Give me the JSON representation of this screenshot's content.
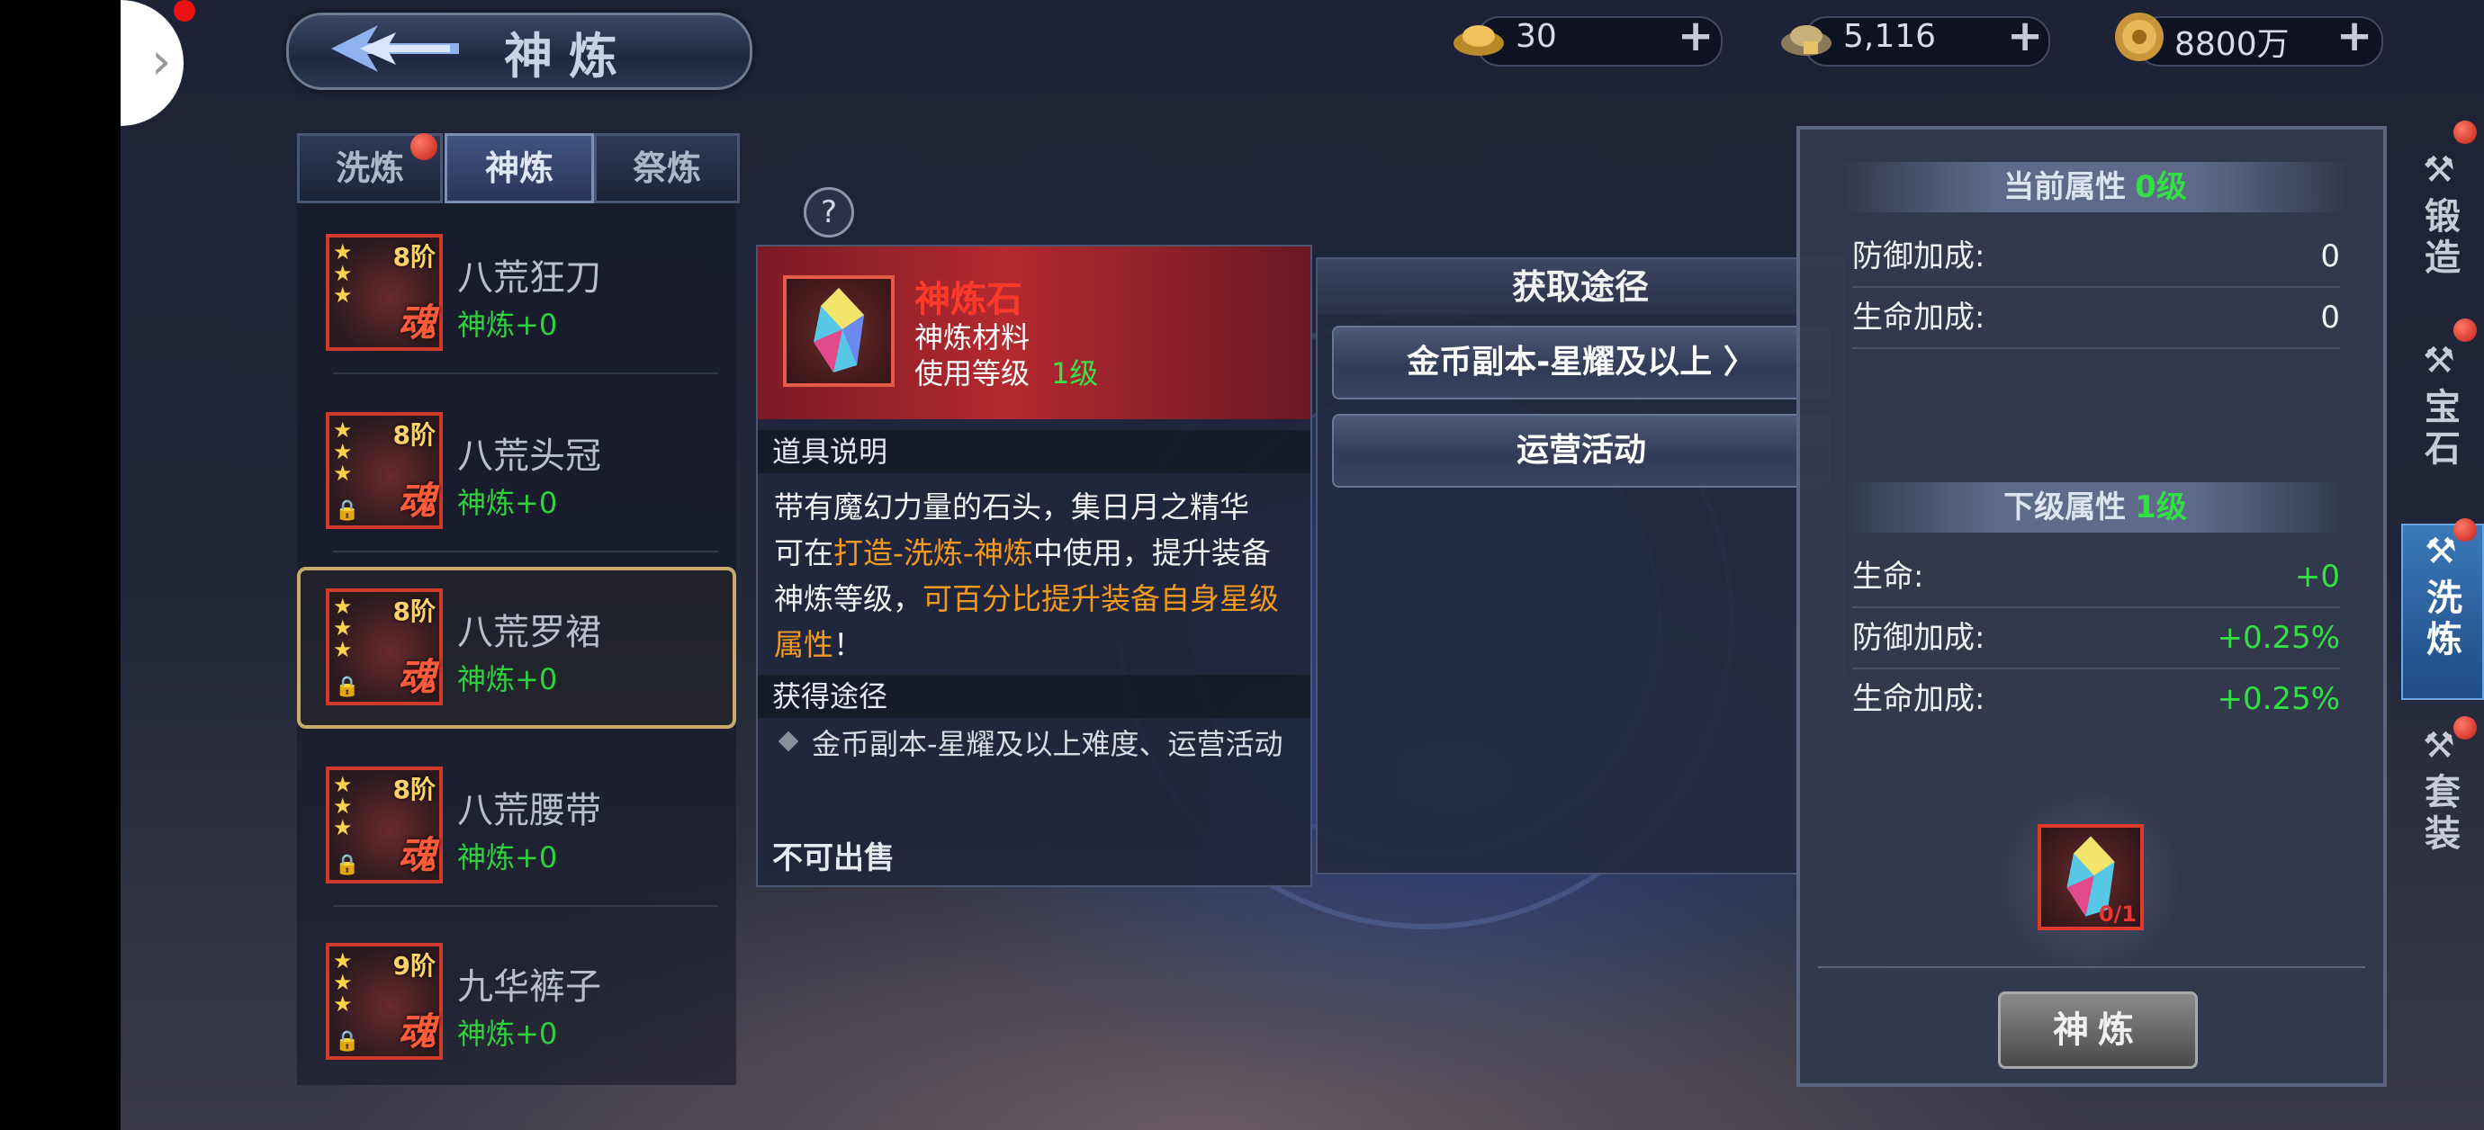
{
  "header": {
    "title": "神炼"
  },
  "currencies": [
    {
      "icon": "gold-ingot-icon",
      "value": "30"
    },
    {
      "icon": "locked-ingot-icon",
      "value": "5,116"
    },
    {
      "icon": "gold-coin-icon",
      "value": "8800万"
    }
  ],
  "tabs": [
    {
      "label": "洗炼",
      "has_dot": true
    },
    {
      "label": "神炼",
      "active": true
    },
    {
      "label": "祭炼"
    }
  ],
  "equipment": [
    {
      "name": "八荒狂刀",
      "tier": "8阶",
      "level": "神炼+0",
      "soul": "魂"
    },
    {
      "name": "八荒头冠",
      "tier": "8阶",
      "level": "神炼+0",
      "soul": "魂"
    },
    {
      "name": "八荒罗裙",
      "tier": "8阶",
      "level": "神炼+0",
      "soul": "魂",
      "selected": true
    },
    {
      "name": "八荒腰带",
      "tier": "8阶",
      "level": "神炼+0",
      "soul": "魂"
    },
    {
      "name": "九华裤子",
      "tier": "9阶",
      "level": "神炼+0",
      "soul": "魂"
    }
  ],
  "help": "?",
  "item_popup": {
    "name": "神炼石",
    "type": "神炼材料",
    "use_level_label": "使用等级",
    "use_level_value": "1级",
    "desc_header": "道具说明",
    "desc_1": "带有魔幻力量的石头，集日月之精华",
    "desc_2a": "可在",
    "desc_2b": "打造-洗炼-神炼",
    "desc_2c": "中使用，提升装备",
    "desc_3a": "神炼等级，",
    "desc_3b": "可百分比提升装备自身星级",
    "desc_4a": "属性",
    "desc_4b": "！",
    "route_header": "获得途径",
    "route_text": "金币副本-星耀及以上难度、运营活动",
    "no_sell": "不可出售"
  },
  "acquire": {
    "title": "获取途径",
    "options": [
      "金币副本-星耀及以上 〉",
      "运营活动"
    ]
  },
  "stats": {
    "current_label": "当前属性",
    "current_level": "0级",
    "current": [
      {
        "key": "防御加成:",
        "value": "0"
      },
      {
        "key": "生命加成:",
        "value": "0"
      }
    ],
    "next_label": "下级属性",
    "next_level": "1级",
    "next": [
      {
        "key": "生命:",
        "value": "+0"
      },
      {
        "key": "防御加成:",
        "value": "+0.25%"
      },
      {
        "key": "生命加成:",
        "value": "+0.25%"
      }
    ],
    "stone_count": "0/1",
    "refine_button": "神炼"
  },
  "side_tabs": [
    {
      "label": "锻造"
    },
    {
      "label": "宝石"
    },
    {
      "label": "洗炼",
      "active": true
    },
    {
      "label": "套装"
    }
  ],
  "colors": {
    "accent_green": "#32e043",
    "accent_orange": "#f39a1e",
    "item_red": "#ff3a2a"
  }
}
